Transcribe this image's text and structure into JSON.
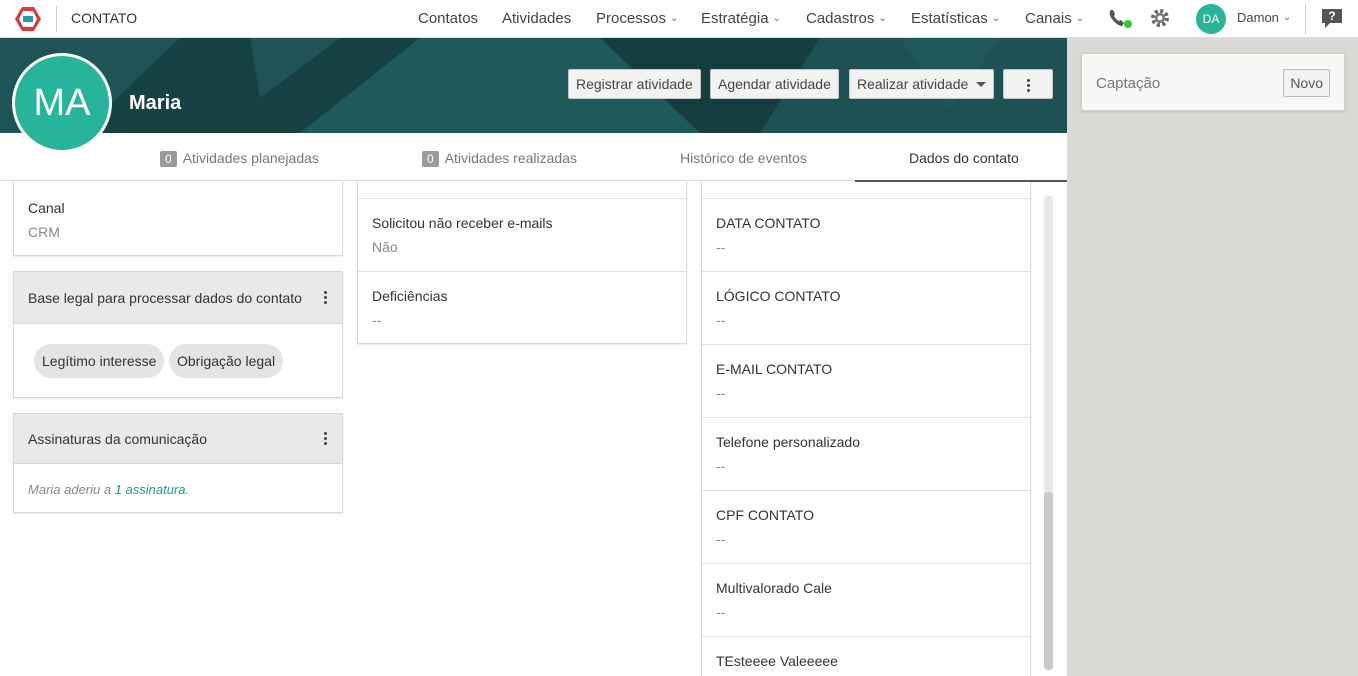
{
  "topbar": {
    "app_title": "CONTATO",
    "nav": [
      {
        "label": "Contatos",
        "dropdown": false
      },
      {
        "label": "Atividades",
        "dropdown": false
      },
      {
        "label": "Processos",
        "dropdown": true
      },
      {
        "label": "Estratégia",
        "dropdown": true
      },
      {
        "label": "Cadastros",
        "dropdown": true
      },
      {
        "label": "Estatísticas",
        "dropdown": true
      },
      {
        "label": "Canais",
        "dropdown": true
      }
    ],
    "user_initials": "DA",
    "user_name": "Damon",
    "status_color": "#2ecc2e"
  },
  "header": {
    "avatar_initials": "MA",
    "contact_name": "Maria",
    "buttons": {
      "register": "Registrar atividade",
      "schedule": "Agendar atividade",
      "perform": "Realizar atividade"
    }
  },
  "tabs": [
    {
      "count": "0",
      "label": "Atividades planejadas"
    },
    {
      "count": "0",
      "label": "Atividades realizadas"
    },
    {
      "label": "Histórico de eventos"
    },
    {
      "label": "Dados do contato",
      "active": true
    }
  ],
  "left": {
    "canal_label": "Canal",
    "canal_value": "CRM",
    "legal_title": "Base legal para processar dados do contato",
    "legal_chips": [
      "Legítimo interesse",
      "Obrigação legal"
    ],
    "subs_title": "Assinaturas da comunicação",
    "subs_prefix": "Maria aderiu a ",
    "subs_link": "1 assinatura",
    "subs_suffix": "."
  },
  "middle": {
    "fields": [
      {
        "label": "Solicitou não receber e-mails",
        "value": "Não"
      },
      {
        "label": "Deficiências",
        "value": "--"
      }
    ]
  },
  "right": {
    "fields": [
      {
        "label": "DATA CONTATO",
        "value": "--"
      },
      {
        "label": "LÓGICO CONTATO",
        "value": "--"
      },
      {
        "label": "E-MAIL CONTATO",
        "value": "--"
      },
      {
        "label": "Telefone personalizado",
        "value": "--"
      },
      {
        "label": "CPF CONTATO",
        "value": "--"
      },
      {
        "label": "Multivalorado Cale",
        "value": "--"
      },
      {
        "label": "TEsteeee Valeeeee",
        "value": ""
      }
    ]
  },
  "side_panel": {
    "title": "Captação",
    "new_button": "Novo"
  },
  "colors": {
    "accent": "#26b59a",
    "banner": "#1b4a4d",
    "link": "#1f9c8c"
  }
}
